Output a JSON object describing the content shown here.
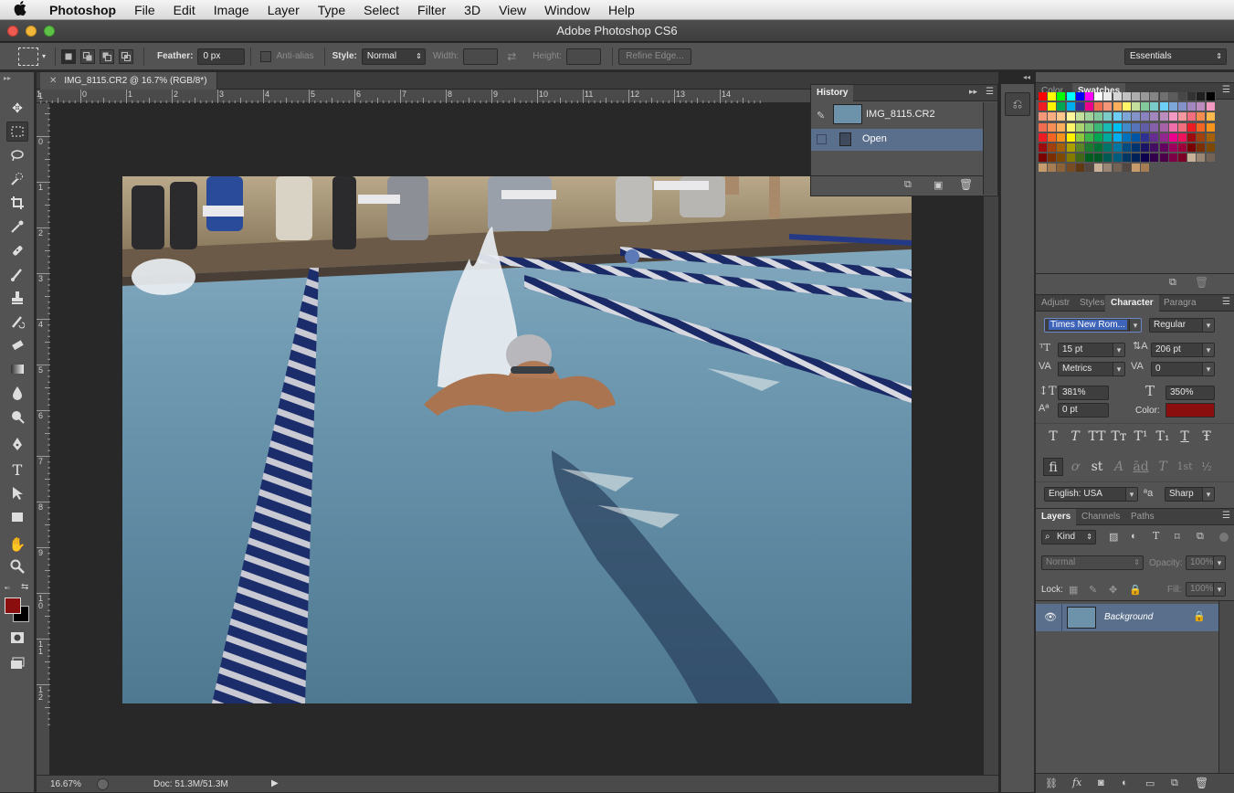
{
  "menubar": {
    "app": "Photoshop",
    "items": [
      "File",
      "Edit",
      "Image",
      "Layer",
      "Type",
      "Select",
      "Filter",
      "3D",
      "View",
      "Window",
      "Help"
    ]
  },
  "window": {
    "title": "Adobe Photoshop CS6"
  },
  "options_bar": {
    "feather_label": "Feather:",
    "feather_value": "0 px",
    "antialias_label": "Anti-alias",
    "style_label": "Style:",
    "style_value": "Normal",
    "width_label": "Width:",
    "height_label": "Height:",
    "refine_edge": "Refine Edge...",
    "workspace": "Essentials"
  },
  "document": {
    "tab_title": "IMG_8115.CR2 @ 16.7% (RGB/8*)",
    "h_ruler": [
      "1",
      "0",
      "1",
      "2",
      "3",
      "4",
      "5",
      "6",
      "7",
      "8",
      "9",
      "10",
      "11",
      "12",
      "13",
      "14"
    ],
    "v_ruler": [
      "1",
      "0",
      "1",
      "2",
      "3",
      "4",
      "5",
      "6",
      "7",
      "8",
      "9",
      "1\n0",
      "1\n1",
      "1\n2"
    ]
  },
  "status": {
    "zoom": "16.67%",
    "doc": "Doc: 51.3M/51.3M"
  },
  "history": {
    "tab": "History",
    "snapshot": "IMG_8115.CR2",
    "states": [
      "Open"
    ]
  },
  "swatch_panel": {
    "tabs": [
      "Color",
      "Swatches"
    ],
    "active": "Swatches"
  },
  "character": {
    "tabs": [
      "Adjustr",
      "Styles",
      "Character",
      "Paragra"
    ],
    "active": "Character",
    "font_family": "Times New Rom...",
    "font_style": "Regular",
    "font_size": "15 pt",
    "leading": "206 pt",
    "kerning": "Metrics",
    "tracking": "0",
    "vertical_scale": "381%",
    "horizontal_scale": "350%",
    "baseline_shift": "0 pt",
    "color_label": "Color:",
    "color": "#8b0e0e",
    "style_buttons": [
      "T",
      "T",
      "TT",
      "Tт",
      "T¹",
      "T₁",
      "T",
      "Ŧ"
    ],
    "opentype_buttons": [
      "fi",
      "ơ",
      "st",
      "A",
      "ād",
      "T",
      "1st",
      "½"
    ],
    "language": "English: USA",
    "aa_label": "ªa",
    "antialias": "Sharp"
  },
  "layers": {
    "tabs": [
      "Layers",
      "Channels",
      "Paths"
    ],
    "active": "Layers",
    "filter": "Kind",
    "blend_mode": "Normal",
    "opacity_label": "Opacity:",
    "opacity": "100%",
    "lock_label": "Lock:",
    "fill_label": "Fill:",
    "fill": "100%",
    "items": [
      {
        "name": "Background",
        "visible": true,
        "locked": true
      }
    ]
  },
  "colors": {
    "foreground": "#8b0e0e",
    "background": "#000000",
    "panel": "#535353",
    "selection": "#5a6f8c"
  }
}
